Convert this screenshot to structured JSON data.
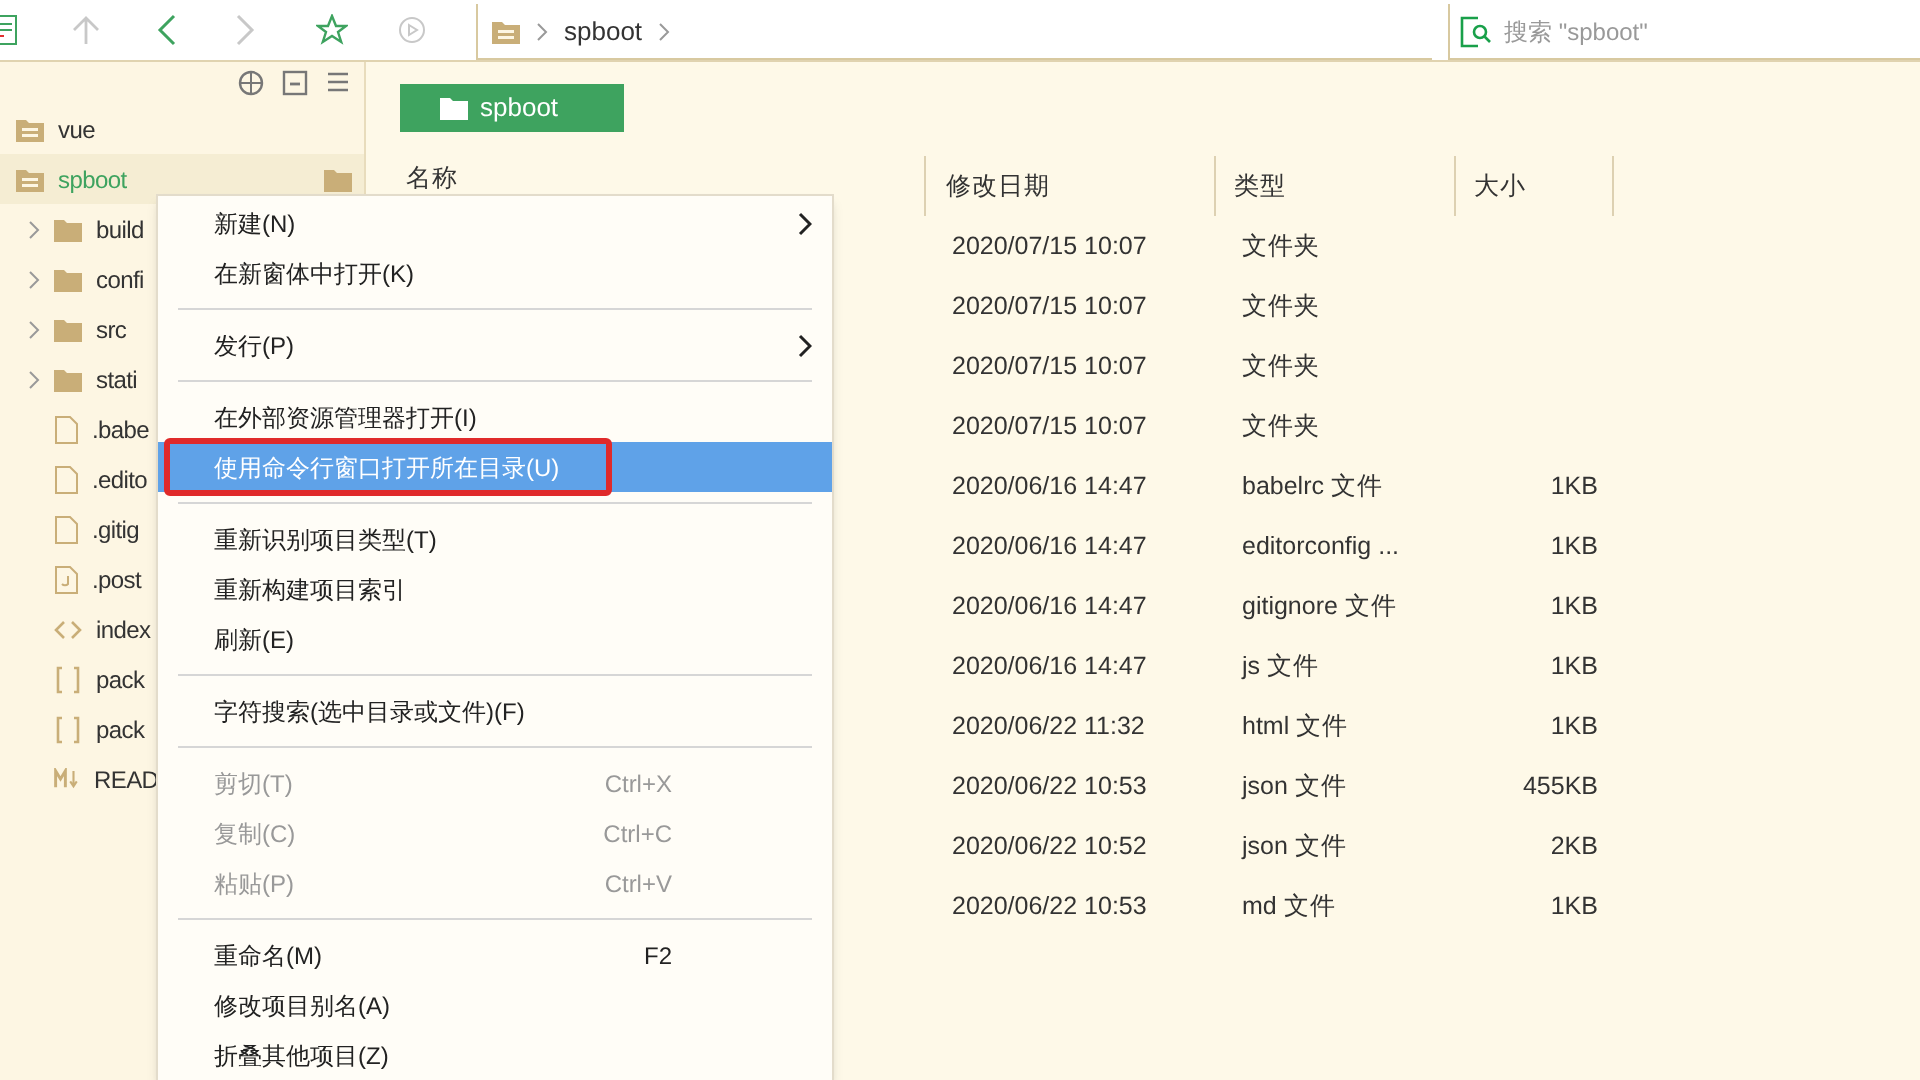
{
  "breadcrumb": [
    "spboot"
  ],
  "search": {
    "placeholder": "搜索 \"spboot\""
  },
  "sidebar": {
    "items": [
      {
        "label": "vue",
        "kind": "project",
        "selected": false
      },
      {
        "label": "spboot",
        "kind": "project",
        "selected": true,
        "children": [
          {
            "label": "build",
            "kind": "folder",
            "selected": false
          },
          {
            "label": "confi",
            "kind": "folder",
            "selected": false
          },
          {
            "label": "src",
            "kind": "folder",
            "selected": false
          },
          {
            "label": "stati",
            "kind": "folder",
            "selected": false
          },
          {
            "label": ".babe",
            "kind": "file",
            "selected": false
          },
          {
            "label": ".edito",
            "kind": "file",
            "selected": false
          },
          {
            "label": ".gitig",
            "kind": "file",
            "selected": false
          },
          {
            "label": ".post",
            "kind": "script",
            "selected": false
          },
          {
            "label": "index",
            "kind": "code",
            "selected": false
          },
          {
            "label": "pack",
            "kind": "json",
            "selected": false
          },
          {
            "label": "pack",
            "kind": "json",
            "selected": false
          },
          {
            "label": "READ",
            "kind": "markdown",
            "selected": false
          }
        ]
      }
    ]
  },
  "folder_title": "spboot",
  "table": {
    "columns": [
      "名称",
      "修改日期",
      "类型",
      "大小"
    ],
    "rows": [
      [
        "",
        "2020/07/15 10:07",
        "文件夹",
        ""
      ],
      [
        "",
        "2020/07/15 10:07",
        "文件夹",
        ""
      ],
      [
        "",
        "2020/07/15 10:07",
        "文件夹",
        ""
      ],
      [
        "",
        "2020/07/15 10:07",
        "文件夹",
        ""
      ],
      [
        "",
        "2020/06/16 14:47",
        "babelrc 文件",
        "1KB"
      ],
      [
        "",
        "2020/06/16 14:47",
        "editorconfig ...",
        "1KB"
      ],
      [
        "",
        "2020/06/16 14:47",
        "gitignore 文件",
        "1KB"
      ],
      [
        "",
        "2020/06/16 14:47",
        "js 文件",
        "1KB"
      ],
      [
        "",
        "2020/06/22 11:32",
        "html 文件",
        "1KB"
      ],
      [
        "",
        "2020/06/22 10:53",
        "json 文件",
        "455KB"
      ],
      [
        "",
        "2020/06/22 10:52",
        "json 文件",
        "2KB"
      ],
      [
        "",
        "2020/06/22 10:53",
        "md 文件",
        "1KB"
      ]
    ]
  },
  "context_menu": [
    {
      "kind": "item",
      "label": "新建(N)",
      "submenu": true,
      "disabled": false,
      "selected": false,
      "annotated": false
    },
    {
      "kind": "item",
      "label": "在新窗体中打开(K)",
      "submenu": false,
      "disabled": false,
      "selected": false,
      "annotated": false
    },
    {
      "kind": "separator"
    },
    {
      "kind": "item",
      "label": "发行(P)",
      "submenu": true,
      "disabled": false,
      "selected": false,
      "annotated": false
    },
    {
      "kind": "separator"
    },
    {
      "kind": "item",
      "label": "在外部资源管理器打开(I)",
      "submenu": false,
      "disabled": false,
      "selected": false,
      "annotated": false
    },
    {
      "kind": "item",
      "label": "使用命令行窗口打开所在目录(U)",
      "submenu": false,
      "disabled": false,
      "selected": true,
      "annotated": true
    },
    {
      "kind": "separator"
    },
    {
      "kind": "item",
      "label": "重新识别项目类型(T)",
      "submenu": false,
      "disabled": false,
      "selected": false,
      "annotated": false
    },
    {
      "kind": "item",
      "label": "重新构建项目索引",
      "submenu": false,
      "disabled": false,
      "selected": false,
      "annotated": false
    },
    {
      "kind": "item",
      "label": "刷新(E)",
      "submenu": false,
      "disabled": false,
      "selected": false,
      "annotated": false
    },
    {
      "kind": "separator"
    },
    {
      "kind": "item",
      "label": "字符搜索(选中目录或文件)(F)",
      "submenu": false,
      "disabled": false,
      "selected": false,
      "annotated": false
    },
    {
      "kind": "separator"
    },
    {
      "kind": "item",
      "label": "剪切(T)",
      "shortcut": "Ctrl+X",
      "submenu": false,
      "disabled": true,
      "selected": false,
      "annotated": false
    },
    {
      "kind": "item",
      "label": "复制(C)",
      "shortcut": "Ctrl+C",
      "submenu": false,
      "disabled": true,
      "selected": false,
      "annotated": false
    },
    {
      "kind": "item",
      "label": "粘贴(P)",
      "shortcut": "Ctrl+V",
      "submenu": false,
      "disabled": true,
      "selected": false,
      "annotated": false
    },
    {
      "kind": "separator"
    },
    {
      "kind": "item",
      "label": "重命名(M)",
      "shortcut": "F2",
      "submenu": false,
      "disabled": false,
      "selected": false,
      "annotated": false
    },
    {
      "kind": "item",
      "label": "修改项目别名(A)",
      "submenu": false,
      "disabled": false,
      "selected": false,
      "annotated": false
    },
    {
      "kind": "item",
      "label": "折叠其他项目(Z)",
      "submenu": false,
      "disabled": false,
      "selected": false,
      "annotated": false
    }
  ]
}
